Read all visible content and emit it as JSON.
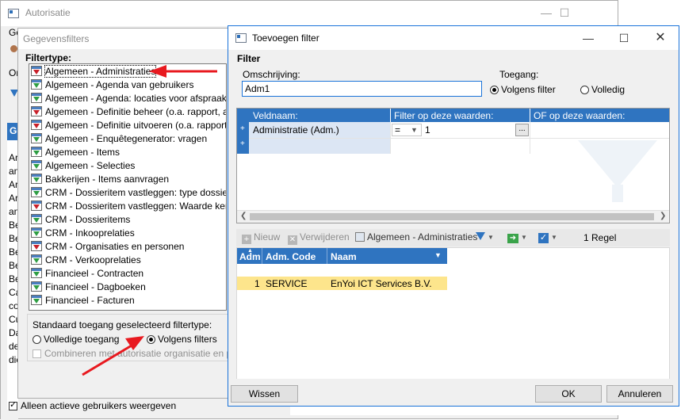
{
  "autorisatie": {
    "title": "Autorisatie",
    "bottom_checkbox": "Alleen actieve gebruikers weergeven",
    "left_labels": [
      "Ge",
      "Or",
      "Ge",
      "Ar",
      "an",
      "Ar",
      "Ar",
      "an",
      "Be",
      "Be",
      "Be",
      "Be",
      "Be",
      "Ca",
      "co",
      "Cu",
      "Da",
      "de",
      "die"
    ]
  },
  "gegevensfilters": {
    "title": "Gegevensfilters",
    "filtertype_label": "Filtertype:",
    "items": [
      {
        "label": "Algemeen - Administraties",
        "icon": "filter-red-icon"
      },
      {
        "label": "Algemeen - Agenda van gebruikers",
        "icon": "filter-green-icon"
      },
      {
        "label": "Algemeen - Agenda: locaties voor afspraak",
        "icon": "filter-green-icon"
      },
      {
        "label": "Algemeen - Definitie beheer (o.a. rapport, anal...",
        "icon": "filter-red-icon"
      },
      {
        "label": "Algemeen - Definitie uitvoeren (o.a. rapport, an...",
        "icon": "filter-red-icon"
      },
      {
        "label": "Algemeen - Enquêtegenerator: vragen",
        "icon": "filter-green-icon"
      },
      {
        "label": "Algemeen - Items",
        "icon": "filter-green-icon"
      },
      {
        "label": "Algemeen - Selecties",
        "icon": "filter-green-icon"
      },
      {
        "label": "Bakkerijen - Items aanvragen",
        "icon": "filter-green-icon"
      },
      {
        "label": "CRM - Dossieritem vastleggen: type dossieritem",
        "icon": "filter-green-icon"
      },
      {
        "label": "CRM - Dossieritem vastleggen: Waarde kenm...",
        "icon": "filter-red-icon"
      },
      {
        "label": "CRM - Dossieritems",
        "icon": "filter-green-icon"
      },
      {
        "label": "CRM - Inkooprelaties",
        "icon": "filter-green-icon"
      },
      {
        "label": "CRM - Organisaties en personen",
        "icon": "filter-red-icon"
      },
      {
        "label": "CRM - Verkooprelaties",
        "icon": "filter-green-icon"
      },
      {
        "label": "Financieel - Contracten",
        "icon": "filter-green-icon"
      },
      {
        "label": "Financieel - Dagboeken",
        "icon": "filter-green-icon"
      },
      {
        "label": "Financieel - Facturen",
        "icon": "filter-green-icon"
      }
    ],
    "standard_label": "Standaard toegang geselecteerd filtertype:",
    "radio_full": "Volledige toegang",
    "radio_filters": "Volgens filters",
    "combine_label": "Combineren met autorisatie organisatie en persoon"
  },
  "toevoegen": {
    "title": "Toevoegen filter",
    "section": "Filter",
    "omschrijving_label": "Omschrijving:",
    "omschrijving_value": "Adm1",
    "toegang_label": "Toegang:",
    "toegang_filter": "Volgens filter",
    "toegang_full": "Volledig",
    "grid_headers": [
      "Veldnaam:",
      "Filter op deze waarden:",
      "OF op deze waarden:"
    ],
    "grid_row": {
      "field": "Administratie (Adm.)",
      "operator": "=",
      "value": "1",
      "ellipsis": "..."
    },
    "toolbar": {
      "new": "Nieuw",
      "delete": "Verwijderen",
      "source": "Algemeen - Administraties",
      "count": "1 Regel"
    },
    "result_headers": [
      "Adm",
      "Adm. Code",
      "Naam"
    ],
    "result_row": {
      "adm": "1",
      "code": "SERVICE",
      "naam": "EnYoi ICT Services B.V."
    },
    "btn_clear": "Wissen",
    "btn_ok": "OK",
    "btn_cancel": "Annuleren"
  },
  "colors": {
    "accent": "#2f74c0",
    "selection": "#fde58c",
    "annotation": "#e8191f"
  }
}
